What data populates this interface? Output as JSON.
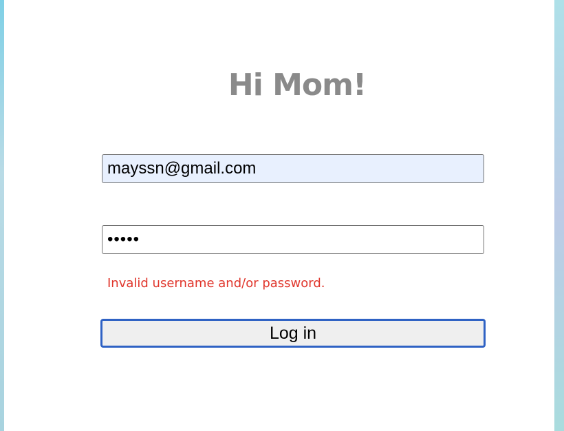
{
  "login_form": {
    "title": "Hi Mom!",
    "email_value": "mayssn@gmail.com",
    "password_value": "•••••",
    "error_message": "Invalid username and/or password.",
    "login_button_label": "Log in"
  },
  "colors": {
    "title": "#8a8a8a",
    "error": "#e0352b",
    "button_border": "#2f62c4",
    "autofill_background": "#e8f0fe"
  }
}
